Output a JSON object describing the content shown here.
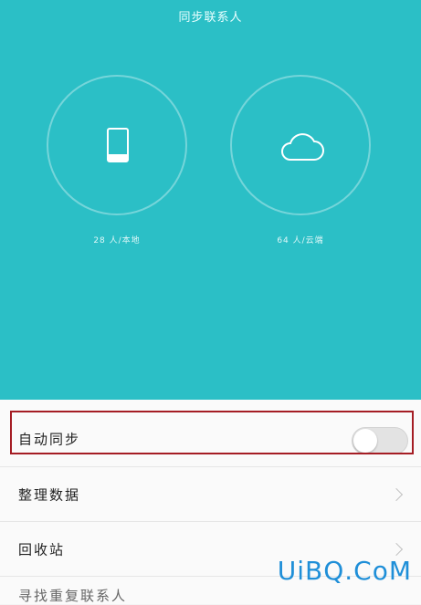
{
  "header": {
    "title": "同步联系人"
  },
  "stats": {
    "local": {
      "label": "28 人/本地",
      "icon": "phone-icon"
    },
    "cloud": {
      "label": "64 人/云端",
      "icon": "cloud-icon"
    }
  },
  "settings": {
    "auto_sync": {
      "label": "自动同步",
      "enabled": false
    },
    "organize": {
      "label": "整理数据"
    },
    "recycle_bin": {
      "label": "回收站"
    },
    "more": {
      "label": "寻找重复联系人"
    }
  },
  "watermark": {
    "text": "UiBQ.CoM"
  },
  "colors": {
    "accent": "#2bbfc6",
    "highlight": "#a51d24",
    "watermark": "#1f8fd8"
  }
}
